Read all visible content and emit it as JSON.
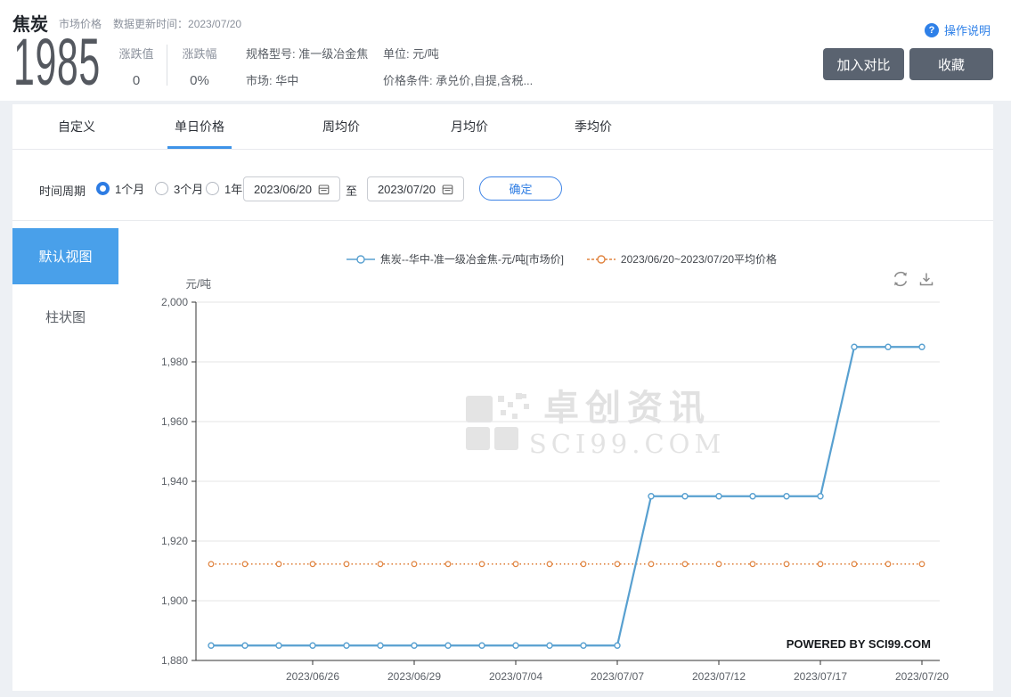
{
  "header": {
    "product": "焦炭",
    "category": "市场价格",
    "update_label": "数据更新时间：",
    "update_value": "2023/07/20",
    "help_icon": "?",
    "help_label": "操作说明",
    "price": "1985",
    "change_label": "涨跌值",
    "change_value": "0",
    "change_pct_label": "涨跌幅",
    "change_pct_value": "0%",
    "spec": "规格型号: 准一级冶金焦",
    "market": "市场: 华中",
    "unit": "单位: 元/吨",
    "condition": "价格条件: 承兑价,自提,含税...",
    "compare_button": "加入对比",
    "favorite_button": "收藏"
  },
  "tabs": [
    {
      "label": "自定义",
      "active": false
    },
    {
      "label": "单日价格",
      "active": true
    },
    {
      "label": "周均价",
      "active": false
    },
    {
      "label": "月均价",
      "active": false
    },
    {
      "label": "季均价",
      "active": false
    }
  ],
  "filter": {
    "period_label": "时间周期",
    "periods": [
      {
        "label": "1个月",
        "selected": true
      },
      {
        "label": "3个月",
        "selected": false
      },
      {
        "label": "1年",
        "selected": false
      }
    ],
    "start_date": "2023/06/20",
    "range_separator": "至",
    "end_date": "2023/07/20",
    "confirm_button": "确定"
  },
  "sidebar": {
    "items": [
      {
        "label": "默认视图",
        "active": true
      },
      {
        "label": "柱状图",
        "active": false
      }
    ]
  },
  "colors": {
    "accent_blue": "#2d7ce3",
    "sidebar_active_blue": "#49a0ea",
    "tab_underline_blue": "#3e93e8",
    "dark_button": "#5a6370",
    "series_blue": "#58a0d0",
    "average_orange": "#e0833f"
  },
  "chart_data": {
    "type": "line",
    "title": "",
    "xlabel": "",
    "ylabel": "元/吨",
    "grid": true,
    "legend_position": "top-center",
    "legend": [
      "焦炭--华中-准一级冶金焦-元/吨[市场价]",
      "2023/06/20~2023/07/20平均价格"
    ],
    "x": [
      "2023/06/20",
      "2023/06/21",
      "2023/06/25",
      "2023/06/26",
      "2023/06/27",
      "2023/06/28",
      "2023/06/29",
      "2023/06/30",
      "2023/07/03",
      "2023/07/04",
      "2023/07/05",
      "2023/07/06",
      "2023/07/07",
      "2023/07/10",
      "2023/07/11",
      "2023/07/12",
      "2023/07/13",
      "2023/07/14",
      "2023/07/17",
      "2023/07/18",
      "2023/07/19",
      "2023/07/20"
    ],
    "xtick_indices": [
      3,
      6,
      9,
      12,
      15,
      18,
      21
    ],
    "ylim": [
      1880,
      2000
    ],
    "yticks": [
      2000,
      1980,
      1960,
      1940,
      1920,
      1900,
      1880
    ],
    "series": [
      {
        "name": "焦炭--华中-准一级冶金焦-元/吨[市场价]",
        "color": "#58a0d0",
        "marker": "circle",
        "style": "solid",
        "values": [
          1885,
          1885,
          1885,
          1885,
          1885,
          1885,
          1885,
          1885,
          1885,
          1885,
          1885,
          1885,
          1885,
          1935,
          1935,
          1935,
          1935,
          1935,
          1935,
          1985,
          1985,
          1985
        ]
      },
      {
        "name": "2023/06/20~2023/07/20平均价格",
        "color": "#e0833f",
        "marker": "circle",
        "style": "dotted",
        "value": 1912.3
      }
    ],
    "watermark": {
      "cn": "卓创资讯",
      "en": "SCI99.COM"
    },
    "powered_by": "POWERED BY SCI99.COM"
  }
}
